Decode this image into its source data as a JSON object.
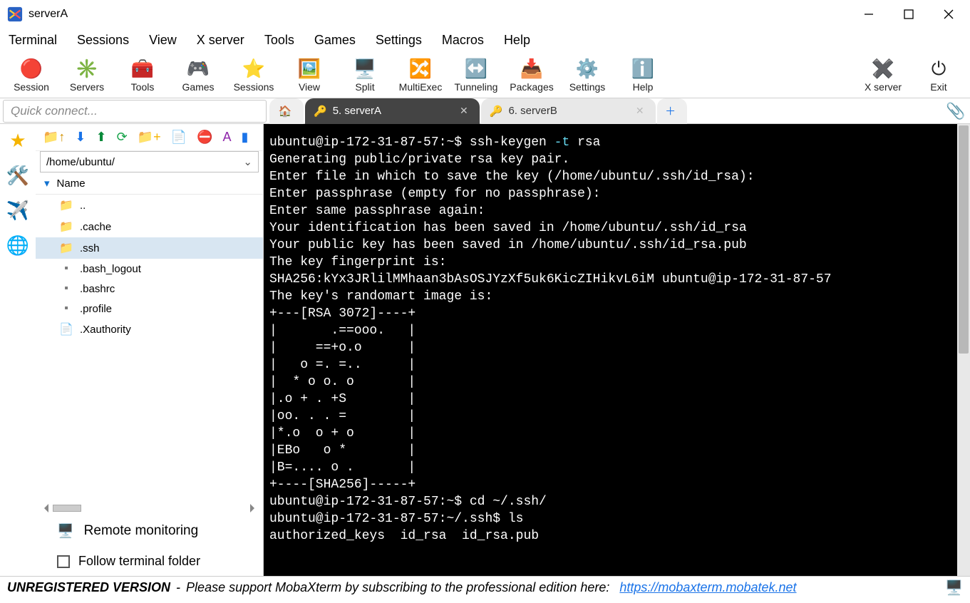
{
  "window": {
    "title": "serverA"
  },
  "menubar": [
    "Terminal",
    "Sessions",
    "View",
    "X server",
    "Tools",
    "Games",
    "Settings",
    "Macros",
    "Help"
  ],
  "toolbar": [
    {
      "label": "Session",
      "icon": "🔴"
    },
    {
      "label": "Servers",
      "icon": "✳️"
    },
    {
      "label": "Tools",
      "icon": "🧰"
    },
    {
      "label": "Games",
      "icon": "🎮"
    },
    {
      "label": "Sessions",
      "icon": "⭐"
    },
    {
      "label": "View",
      "icon": "🖼️"
    },
    {
      "label": "Split",
      "icon": "🖥️"
    },
    {
      "label": "MultiExec",
      "icon": "🔀"
    },
    {
      "label": "Tunneling",
      "icon": "↔️"
    },
    {
      "label": "Packages",
      "icon": "📥"
    },
    {
      "label": "Settings",
      "icon": "⚙️"
    },
    {
      "label": "Help",
      "icon": "ℹ️"
    }
  ],
  "toolbar_right": [
    {
      "label": "X server",
      "icon": "✖️"
    },
    {
      "label": "Exit",
      "icon": "⏻"
    }
  ],
  "quick_connect_placeholder": "Quick connect...",
  "tabs": {
    "active": {
      "label": "5. serverA"
    },
    "inactive": {
      "label": "6. serverB"
    }
  },
  "file_panel": {
    "path": "/home/ubuntu/",
    "name_header": "Name",
    "items": [
      {
        "name": "..",
        "type": "up"
      },
      {
        "name": ".cache",
        "type": "folder"
      },
      {
        "name": ".ssh",
        "type": "folder",
        "selected": true
      },
      {
        "name": ".bash_logout",
        "type": "file"
      },
      {
        "name": ".bashrc",
        "type": "file"
      },
      {
        "name": ".profile",
        "type": "file"
      },
      {
        "name": ".Xauthority",
        "type": "doc"
      }
    ],
    "remote_monitoring": "Remote monitoring",
    "follow_terminal": "Follow terminal folder"
  },
  "terminal": {
    "lines": [
      {
        "t": "prompt",
        "text": "ubuntu@ip-172-31-87-57:~$ ssh-keygen ",
        "opt": "-t",
        "rest": " rsa"
      },
      {
        "t": "plain",
        "text": "Generating public/private rsa key pair."
      },
      {
        "t": "plain",
        "text": "Enter file in which to save the key (/home/ubuntu/.ssh/id_rsa):"
      },
      {
        "t": "plain",
        "text": "Enter passphrase (empty for no passphrase):"
      },
      {
        "t": "plain",
        "text": "Enter same passphrase again:"
      },
      {
        "t": "plain",
        "text": "Your identification has been saved in /home/ubuntu/.ssh/id_rsa"
      },
      {
        "t": "plain",
        "text": "Your public key has been saved in /home/ubuntu/.ssh/id_rsa.pub"
      },
      {
        "t": "plain",
        "text": "The key fingerprint is:"
      },
      {
        "t": "plain",
        "text": "SHA256:kYx3JRlilMMhaan3bAsOSJYzXf5uk6KicZIHikvL6iM ubuntu@ip-172-31-87-57"
      },
      {
        "t": "plain",
        "text": "The key's randomart image is:"
      },
      {
        "t": "plain",
        "text": "+---[RSA 3072]----+"
      },
      {
        "t": "plain",
        "text": "|       .==ooo.   |"
      },
      {
        "t": "plain",
        "text": "|     ==+o.o      |"
      },
      {
        "t": "plain",
        "text": "|   o =. =..      |"
      },
      {
        "t": "plain",
        "text": "|  * o o. o       |"
      },
      {
        "t": "plain",
        "text": "|.o + . +S        |"
      },
      {
        "t": "plain",
        "text": "|oo. . . =        |"
      },
      {
        "t": "plain",
        "text": "|*.o  o + o       |"
      },
      {
        "t": "plain",
        "text": "|EBo   o *        |"
      },
      {
        "t": "plain",
        "text": "|B=.... o .       |"
      },
      {
        "t": "plain",
        "text": "+----[SHA256]-----+"
      },
      {
        "t": "prompt",
        "text": "ubuntu@ip-172-31-87-57:~$ cd ~/.ssh/"
      },
      {
        "t": "prompt",
        "text": "ubuntu@ip-172-31-87-57:~/.ssh$ ls"
      },
      {
        "t": "plain",
        "text": "authorized_keys  id_rsa  id_rsa.pub"
      }
    ]
  },
  "footer": {
    "unregistered": "UNREGISTERED VERSION",
    "sep": "  -  ",
    "msg": "Please support MobaXterm by subscribing to the professional edition here:",
    "link": "https://mobaxterm.mobatek.net"
  }
}
